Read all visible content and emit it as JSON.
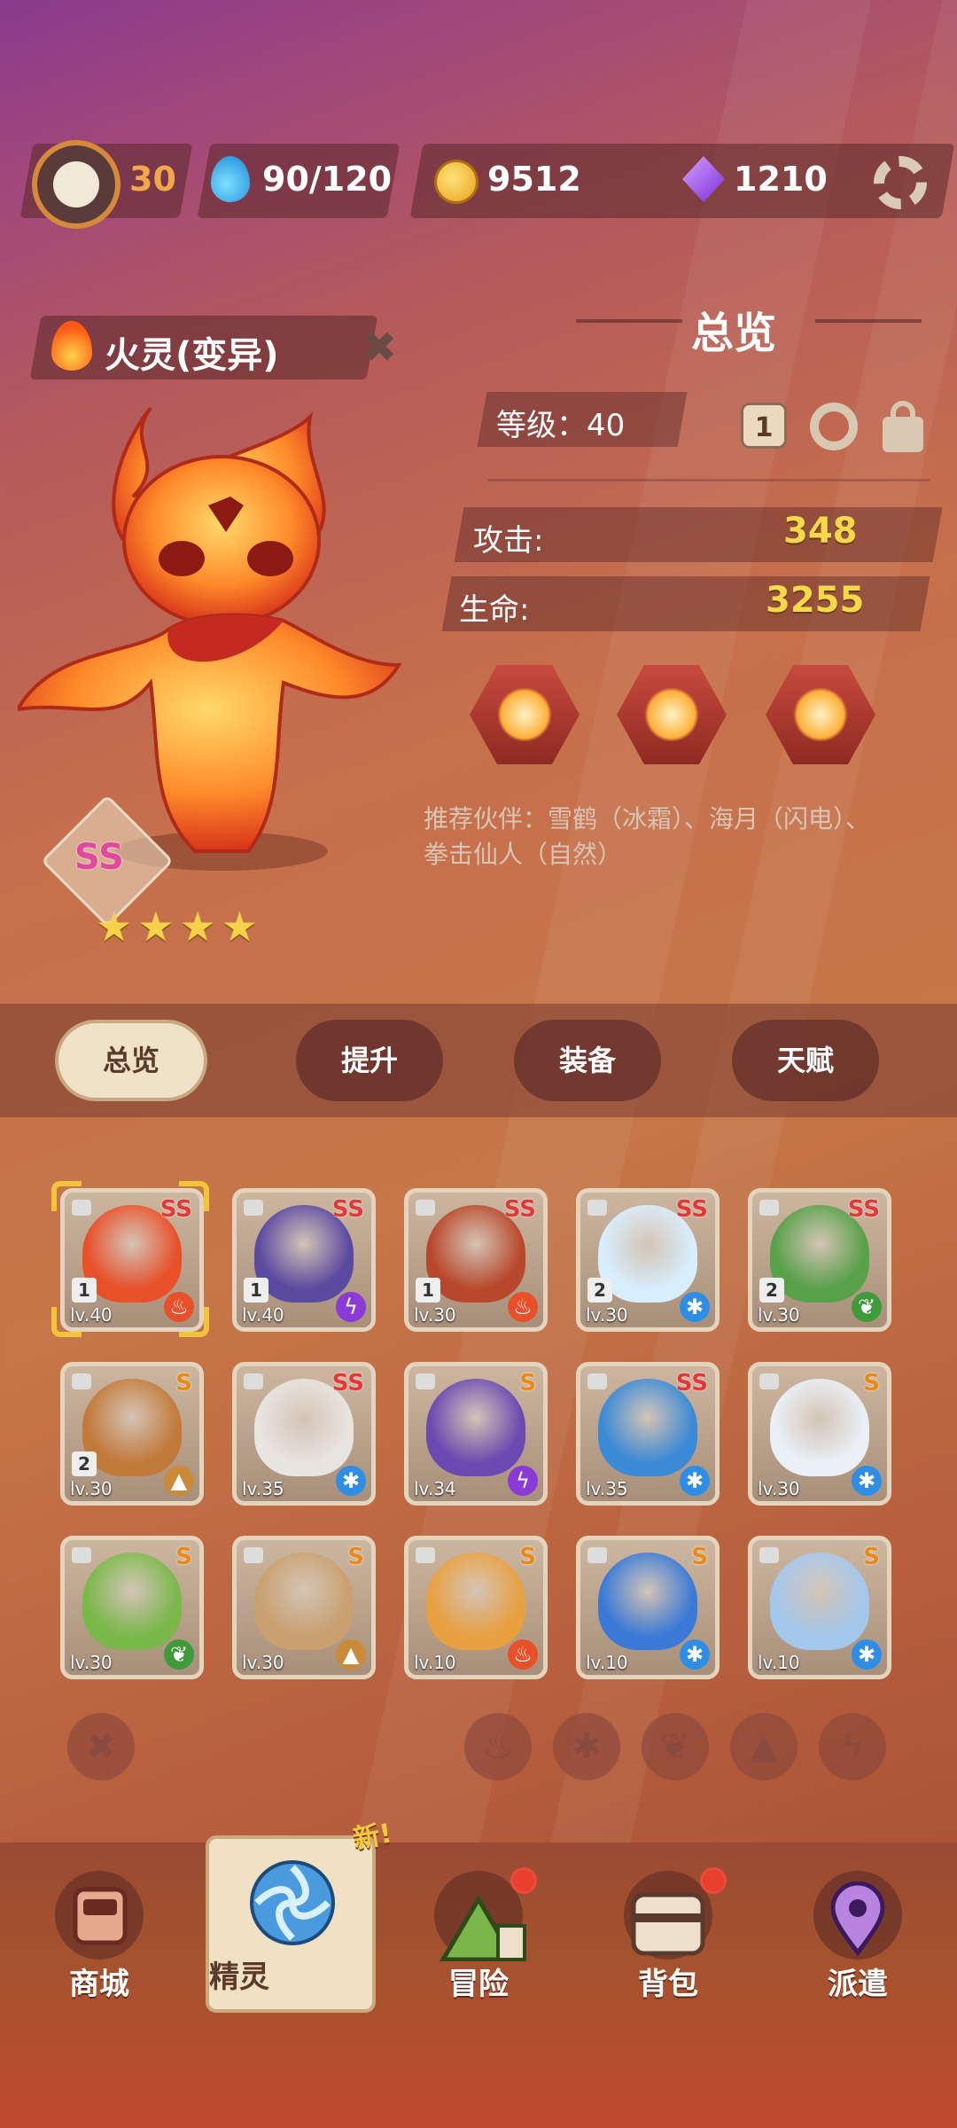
{
  "top_bar": {
    "player_level": "30",
    "stamina": "90/120",
    "coins": "9512",
    "gems": "1210"
  },
  "spirit": {
    "name": "火灵(变异)",
    "grade": "SS",
    "stars": "★★★★"
  },
  "overview": {
    "title": "总览",
    "level_label": "等级：40",
    "badge_number": "1",
    "attack_label": "攻击:",
    "attack_value": "348",
    "hp_label": "生命:",
    "hp_value": "3255",
    "partners": "推荐伙伴：雪鹤（冰霜）、海月（闪电）、拳击仙人（自然）"
  },
  "tabs": [
    {
      "label": "总览",
      "active": true
    },
    {
      "label": "提升",
      "active": false
    },
    {
      "label": "装备",
      "active": false
    },
    {
      "label": "天赋",
      "active": false
    }
  ],
  "cards": [
    {
      "grade": "SS",
      "level": "lv.40",
      "star": "1",
      "element": "fire"
    },
    {
      "grade": "SS",
      "level": "lv.40",
      "star": "1",
      "element": "lightning"
    },
    {
      "grade": "SS",
      "level": "lv.30",
      "star": "1",
      "element": "fire"
    },
    {
      "grade": "SS",
      "level": "lv.30",
      "star": "2",
      "element": "ice"
    },
    {
      "grade": "SS",
      "level": "lv.30",
      "star": "2",
      "element": "nature"
    },
    {
      "grade": "S",
      "level": "lv.30",
      "star": "2",
      "element": "earth"
    },
    {
      "grade": "SS",
      "level": "lv.35",
      "star": "",
      "element": "ice"
    },
    {
      "grade": "S",
      "level": "lv.34",
      "star": "",
      "element": "lightning"
    },
    {
      "grade": "SS",
      "level": "lv.35",
      "star": "",
      "element": "ice"
    },
    {
      "grade": "S",
      "level": "lv.30",
      "star": "",
      "element": "ice"
    },
    {
      "grade": "S",
      "level": "lv.30",
      "star": "",
      "element": "nature"
    },
    {
      "grade": "S",
      "level": "lv.30",
      "star": "",
      "element": "earth"
    },
    {
      "grade": "S",
      "level": "lv.10",
      "star": "",
      "element": "fire"
    },
    {
      "grade": "S",
      "level": "lv.10",
      "star": "",
      "element": "ice"
    },
    {
      "grade": "S",
      "level": "lv.10",
      "star": "",
      "element": "ice"
    }
  ],
  "nav": {
    "new_badge": "新!",
    "items": [
      {
        "label": "商城"
      },
      {
        "label": "精灵"
      },
      {
        "label": "冒险"
      },
      {
        "label": "背包"
      },
      {
        "label": "派遣"
      }
    ]
  },
  "colors": {
    "fire": "#e8502a",
    "ice": "#2e8ee6",
    "nature": "#3f9a3a",
    "earth": "#c98a3a",
    "lightning": "#8a3ad6",
    "accent_gold": "#f6d84a"
  }
}
